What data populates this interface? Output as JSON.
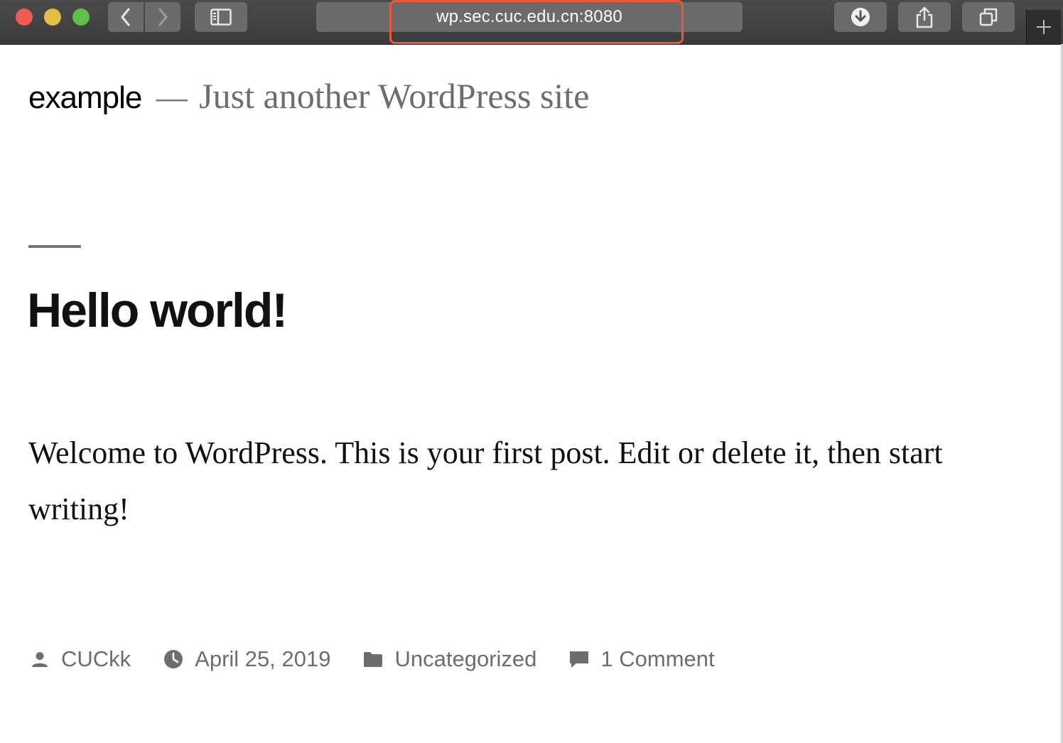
{
  "browser": {
    "url": "wp.sec.cuc.edu.cn:8080",
    "icons": {
      "back": "chevron-left-icon",
      "forward": "chevron-right-icon",
      "sidebar": "sidebar-icon",
      "download": "download-icon",
      "share": "share-icon",
      "tabs": "tabs-overview-icon",
      "new_tab": "plus-icon"
    },
    "highlight_color": "#e85a35"
  },
  "site": {
    "title": "example",
    "separator": "—",
    "tagline": "Just another WordPress site"
  },
  "post": {
    "title": "Hello world!",
    "body": "Welcome to WordPress. This is your first post. Edit or delete it, then start writing!",
    "meta": {
      "author": "CUCkk",
      "date": "April 25, 2019",
      "category": "Uncategorized",
      "comments": "1 Comment"
    }
  },
  "colors": {
    "meta_text": "#6d6d6d",
    "toolbar_bg": "#3b3b3b"
  }
}
